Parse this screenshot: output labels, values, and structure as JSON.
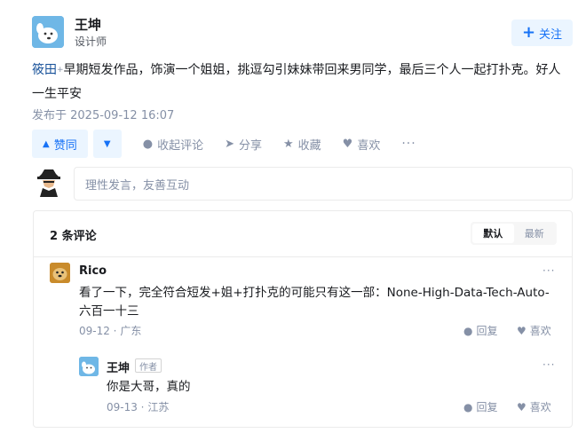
{
  "author": {
    "name": "王坤",
    "title": "设计师",
    "avatar_icon": "dog-avatar-icon"
  },
  "follow": {
    "label": "关注",
    "icon": "plus-icon"
  },
  "content": {
    "tag": "筱田",
    "tag_mark": "+",
    "text": "早期短发作品，饰演一个姐姐，挑逗勾引妹妹带回来男同学，最后三个人一起打扑克。好人一生平安"
  },
  "publish_time": "发布于 2025-09-12 16:07",
  "actions": {
    "vote_up": "赞同",
    "collapse_comments": "收起评论",
    "share": "分享",
    "favorite": "收藏",
    "like": "喜欢",
    "more": "···"
  },
  "reply_box": {
    "placeholder": "理性发言，友善互动"
  },
  "comments": {
    "count_label": "2 条评论",
    "sort_default": "默认",
    "sort_latest": "最新",
    "items": [
      {
        "name": "Rico",
        "text": "看了一下，完全符合短发+姐+打扑克的可能只有这一部：None-High-Data-Tech-Auto-六百一十三",
        "meta": "09-12 · 广东",
        "reply": "回复",
        "like": "喜欢",
        "more": "···"
      },
      {
        "name": "王坤",
        "badge": "作者",
        "text": "你是大哥，真的",
        "meta": "09-13 · 江苏",
        "reply": "回复",
        "like": "喜欢",
        "more": "···"
      }
    ]
  },
  "colors": {
    "accent": "#1772f6",
    "accent_bg": "#ebf5ff",
    "muted": "#8590a6"
  }
}
